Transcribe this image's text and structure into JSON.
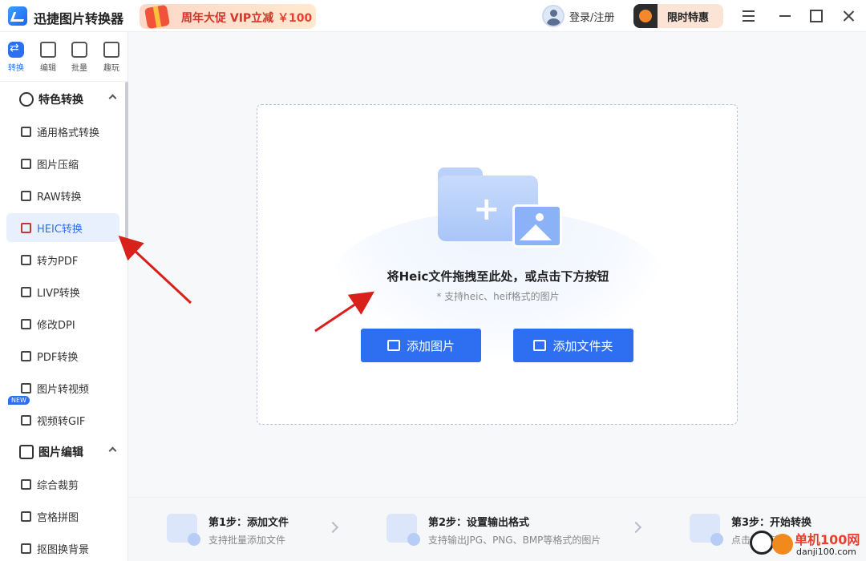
{
  "app": {
    "title": "迅捷图片转换器",
    "promo_text": "周年大促 VIP立减",
    "promo_price": "￥100",
    "login_label": "登录/注册",
    "vip_label": "限时特惠"
  },
  "topnav": [
    {
      "label": "转换",
      "icon": "convert-icon",
      "active": true
    },
    {
      "label": "编辑",
      "icon": "edit-icon"
    },
    {
      "label": "批量",
      "icon": "batch-icon"
    },
    {
      "label": "趣玩",
      "icon": "fun-icon"
    }
  ],
  "sidebar": {
    "group1": {
      "label": "特色转换"
    },
    "items": [
      {
        "label": "通用格式转换"
      },
      {
        "label": "图片压缩"
      },
      {
        "label": "RAW转换"
      },
      {
        "label": "HEIC转换",
        "active": true
      },
      {
        "label": "转为PDF"
      },
      {
        "label": "LIVP转换"
      },
      {
        "label": "修改DPI"
      },
      {
        "label": "PDF转换"
      },
      {
        "label": "图片转视频"
      },
      {
        "label": "视频转GIF",
        "badge": "NEW"
      }
    ],
    "group2": {
      "label": "图片编辑"
    },
    "items2": [
      {
        "label": "综合裁剪"
      },
      {
        "label": "宫格拼图"
      },
      {
        "label": "抠图换背景"
      }
    ]
  },
  "dropzone": {
    "title": "将Heic文件拖拽至此处，或点击下方按钮",
    "subtitle": "* 支持heic、heif格式的图片",
    "add_image": "添加图片",
    "add_folder": "添加文件夹"
  },
  "steps": [
    {
      "title": "第1步：添加文件",
      "desc": "支持批量添加文件"
    },
    {
      "title": "第2步：设置输出格式",
      "desc": "支持输出JPG、PNG、BMP等格式的图片"
    },
    {
      "title": "第3步：开始转换",
      "desc": "点击开始转换"
    }
  ],
  "watermark": {
    "line1": "单机100网",
    "line2": "danji100.com"
  },
  "colors": {
    "accent": "#2e6ff2",
    "annotation": "#d9211c"
  }
}
